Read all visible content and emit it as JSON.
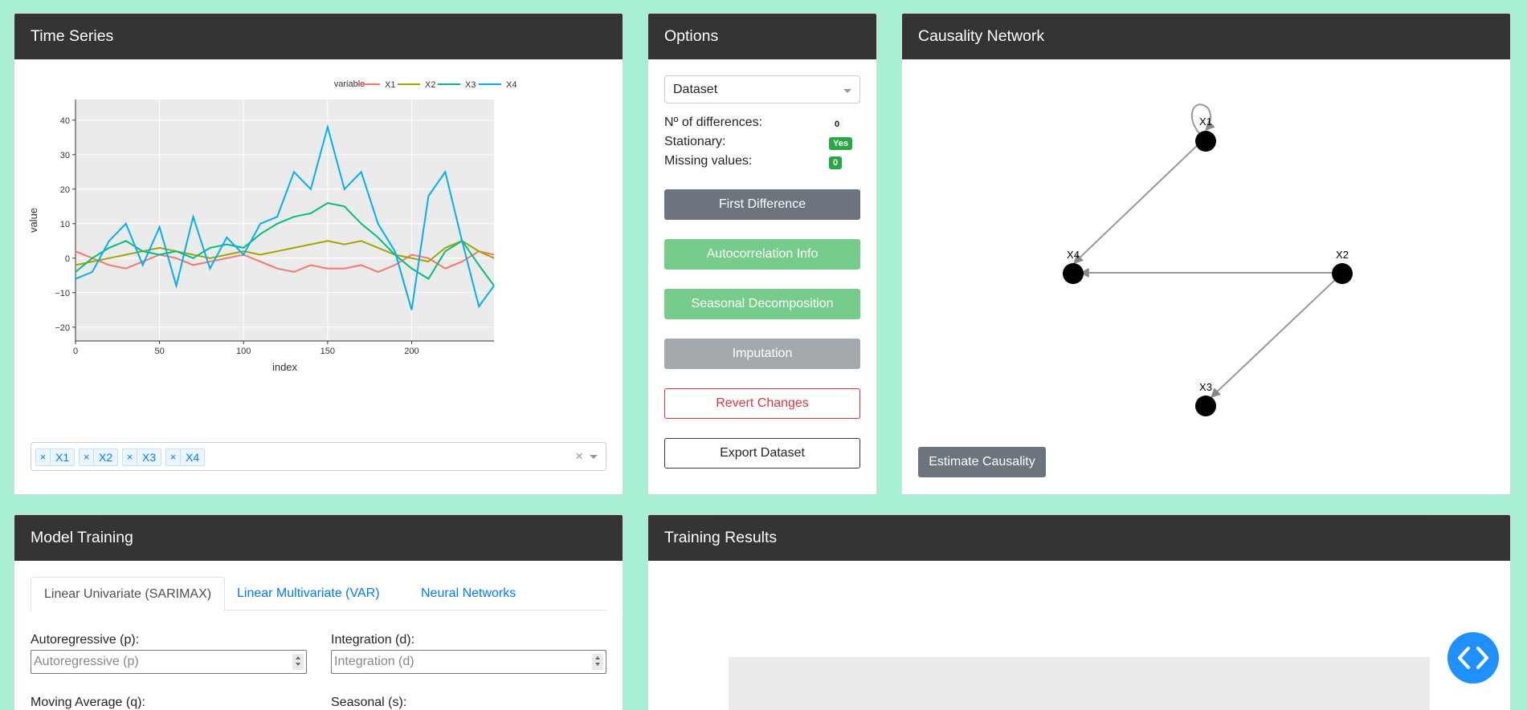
{
  "time_series": {
    "title": "Time Series",
    "legend_title": "variable",
    "xlabel": "index",
    "ylabel": "value",
    "chips": [
      "X1",
      "X2",
      "X3",
      "X4"
    ],
    "clear_glyph": "×",
    "chip_remove_glyph": "×"
  },
  "chart_data": {
    "type": "line",
    "xlabel": "index",
    "ylabel": "value",
    "xlim": [
      0,
      249
    ],
    "ylim": [
      -24,
      46
    ],
    "x_ticks": [
      0,
      50,
      100,
      150,
      200
    ],
    "y_ticks": [
      -20,
      -10,
      0,
      10,
      20,
      30,
      40
    ],
    "x_tick_labels": [
      "0",
      "50",
      "100",
      "150",
      "200"
    ],
    "y_tick_labels": [
      "−20",
      "−10",
      "0",
      "10",
      "20",
      "30",
      "40"
    ],
    "legend_title": "variable",
    "legend_position": "top-right",
    "grid": true,
    "series": [
      {
        "name": "X1",
        "color": "#f8766d",
        "x": [
          0,
          10,
          20,
          30,
          40,
          50,
          60,
          70,
          80,
          90,
          100,
          110,
          120,
          130,
          140,
          150,
          160,
          170,
          180,
          190,
          200,
          210,
          220,
          230,
          240,
          249
        ],
        "values": [
          2,
          0,
          -2,
          -3,
          -1,
          1,
          0,
          -2,
          -1,
          0,
          1,
          -1,
          -3,
          -4,
          -2,
          -3,
          -3,
          -2,
          -4,
          -2,
          1,
          0,
          -3,
          -1,
          2,
          1
        ]
      },
      {
        "name": "X2",
        "color": "#a3a500",
        "x": [
          0,
          10,
          20,
          30,
          40,
          50,
          60,
          70,
          80,
          90,
          100,
          110,
          120,
          130,
          140,
          150,
          160,
          170,
          180,
          190,
          200,
          210,
          220,
          230,
          240,
          249
        ],
        "values": [
          -2,
          -1,
          0,
          1,
          2,
          3,
          2,
          1,
          0,
          1,
          2,
          1,
          2,
          3,
          4,
          5,
          4,
          5,
          3,
          1,
          0,
          -1,
          3,
          5,
          2,
          0
        ]
      },
      {
        "name": "X3",
        "color": "#00bf7d",
        "x": [
          0,
          10,
          20,
          30,
          40,
          50,
          60,
          70,
          80,
          90,
          100,
          110,
          120,
          130,
          140,
          150,
          160,
          170,
          180,
          190,
          200,
          210,
          220,
          230,
          240,
          249
        ],
        "values": [
          -4,
          0,
          3,
          5,
          2,
          1,
          2,
          0,
          3,
          4,
          3,
          7,
          10,
          12,
          13,
          16,
          15,
          10,
          6,
          1,
          -3,
          -6,
          2,
          5,
          -2,
          -8
        ]
      },
      {
        "name": "X4",
        "color": "#00b0f6",
        "x": [
          0,
          10,
          20,
          30,
          40,
          50,
          60,
          70,
          80,
          90,
          100,
          110,
          120,
          130,
          140,
          150,
          160,
          170,
          180,
          190,
          200,
          210,
          220,
          230,
          240,
          249
        ],
        "values": [
          -6,
          -4,
          5,
          10,
          -2,
          9,
          -8,
          12,
          -3,
          6,
          1,
          10,
          12,
          25,
          20,
          38,
          20,
          25,
          10,
          2,
          -15,
          18,
          25,
          5,
          -14,
          -8
        ]
      }
    ]
  },
  "options": {
    "title": "Options",
    "dataset_select": "Dataset",
    "diff_label": "Nº of differences:",
    "diff_value": "0",
    "stationary_label": "Stationary:",
    "stationary_value": "Yes",
    "missing_label": "Missing values:",
    "missing_value": "0",
    "buttons": {
      "first_difference": "First Difference",
      "autocorrelation": "Autocorrelation Info",
      "seasonal": "Seasonal Decomposition",
      "imputation": "Imputation",
      "revert": "Revert Changes",
      "export": "Export Dataset"
    }
  },
  "causality": {
    "title": "Causality Network",
    "nodes": [
      "X1",
      "X2",
      "X3",
      "X4"
    ],
    "edges": [
      [
        "X1",
        "X1"
      ],
      [
        "X1",
        "X4"
      ],
      [
        "X2",
        "X4"
      ],
      [
        "X2",
        "X3"
      ]
    ],
    "estimate_button": "Estimate Causality"
  },
  "model_training": {
    "title": "Model Training",
    "tabs": [
      "Linear Univariate (SARIMAX)",
      "Linear Multivariate (VAR)",
      "Neural Networks"
    ],
    "active_tab": "Linear Univariate (SARIMAX)",
    "fields": {
      "ar_label": "Autoregressive (p):",
      "ar_placeholder": "Autoregressive (p)",
      "int_label": "Integration (d):",
      "int_placeholder": "Integration (d)",
      "ma_label": "Moving Average (q):",
      "seasonal_label": "Seasonal (s):"
    }
  },
  "training_results": {
    "title": "Training Results"
  },
  "colors": {
    "background": "#a8f0d3",
    "header": "#343434",
    "success": "#28a745",
    "danger": "#dc3545",
    "link": "#007bff",
    "fab": "#1e90ff"
  }
}
